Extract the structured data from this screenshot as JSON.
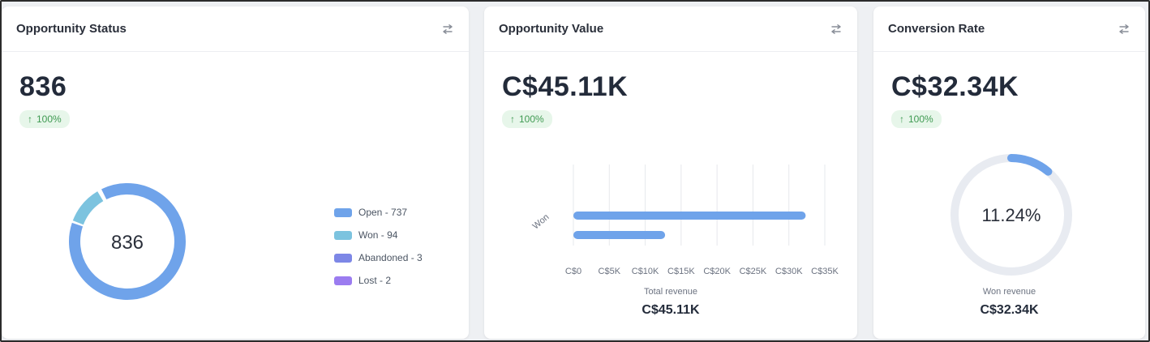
{
  "colors": {
    "accent": "#6fa3ea",
    "won": "#7cc3df",
    "abandoned": "#7d87e6",
    "lost": "#9b7cf0",
    "trend_bg": "#e7f6ea",
    "trend_text": "#3f9a52",
    "track": "#e8ebf1"
  },
  "cards": {
    "status": {
      "title": "Opportunity Status",
      "value": "836",
      "trend": "100%",
      "trend_icon": "arrow-up-icon",
      "center_label": "836"
    },
    "value": {
      "title": "Opportunity Value",
      "value": "C$45.11K",
      "trend": "100%",
      "trend_icon": "arrow-up-icon",
      "caption": "Total revenue",
      "caption_value": "C$45.11K"
    },
    "conversion": {
      "title": "Conversion Rate",
      "value": "C$32.34K",
      "trend": "100%",
      "trend_icon": "arrow-up-icon",
      "center_label": "11.24%",
      "caption": "Won revenue",
      "caption_value": "C$32.34K"
    }
  },
  "legend": [
    {
      "label": "Open - 737",
      "color": "#6fa3ea"
    },
    {
      "label": "Won - 94",
      "color": "#7cc3df"
    },
    {
      "label": "Abandoned - 3",
      "color": "#7d87e6"
    },
    {
      "label": "Lost - 2",
      "color": "#9b7cf0"
    }
  ],
  "chart_data": [
    {
      "type": "pie",
      "title": "",
      "categories": [
        "Open",
        "Won",
        "Abandoned",
        "Lost"
      ],
      "values": [
        737,
        94,
        3,
        2
      ],
      "center_label": "836",
      "legend_position": "right"
    },
    {
      "type": "bar",
      "orientation": "horizontal",
      "categories": [
        "Won"
      ],
      "series": [
        {
          "values": [
            32340
          ]
        },
        {
          "values": [
            12770
          ]
        }
      ],
      "xlim": [
        0,
        35000
      ],
      "x_ticks": [
        "C$0",
        "C$5K",
        "C$10K",
        "C$15K",
        "C$20K",
        "C$25K",
        "C$30K",
        "C$35K"
      ],
      "grid": true,
      "xlabel": "Total revenue"
    },
    {
      "type": "pie",
      "categories": [
        "Won revenue"
      ],
      "values": [
        11.24,
        88.76
      ],
      "center_label": "11.24%"
    }
  ]
}
